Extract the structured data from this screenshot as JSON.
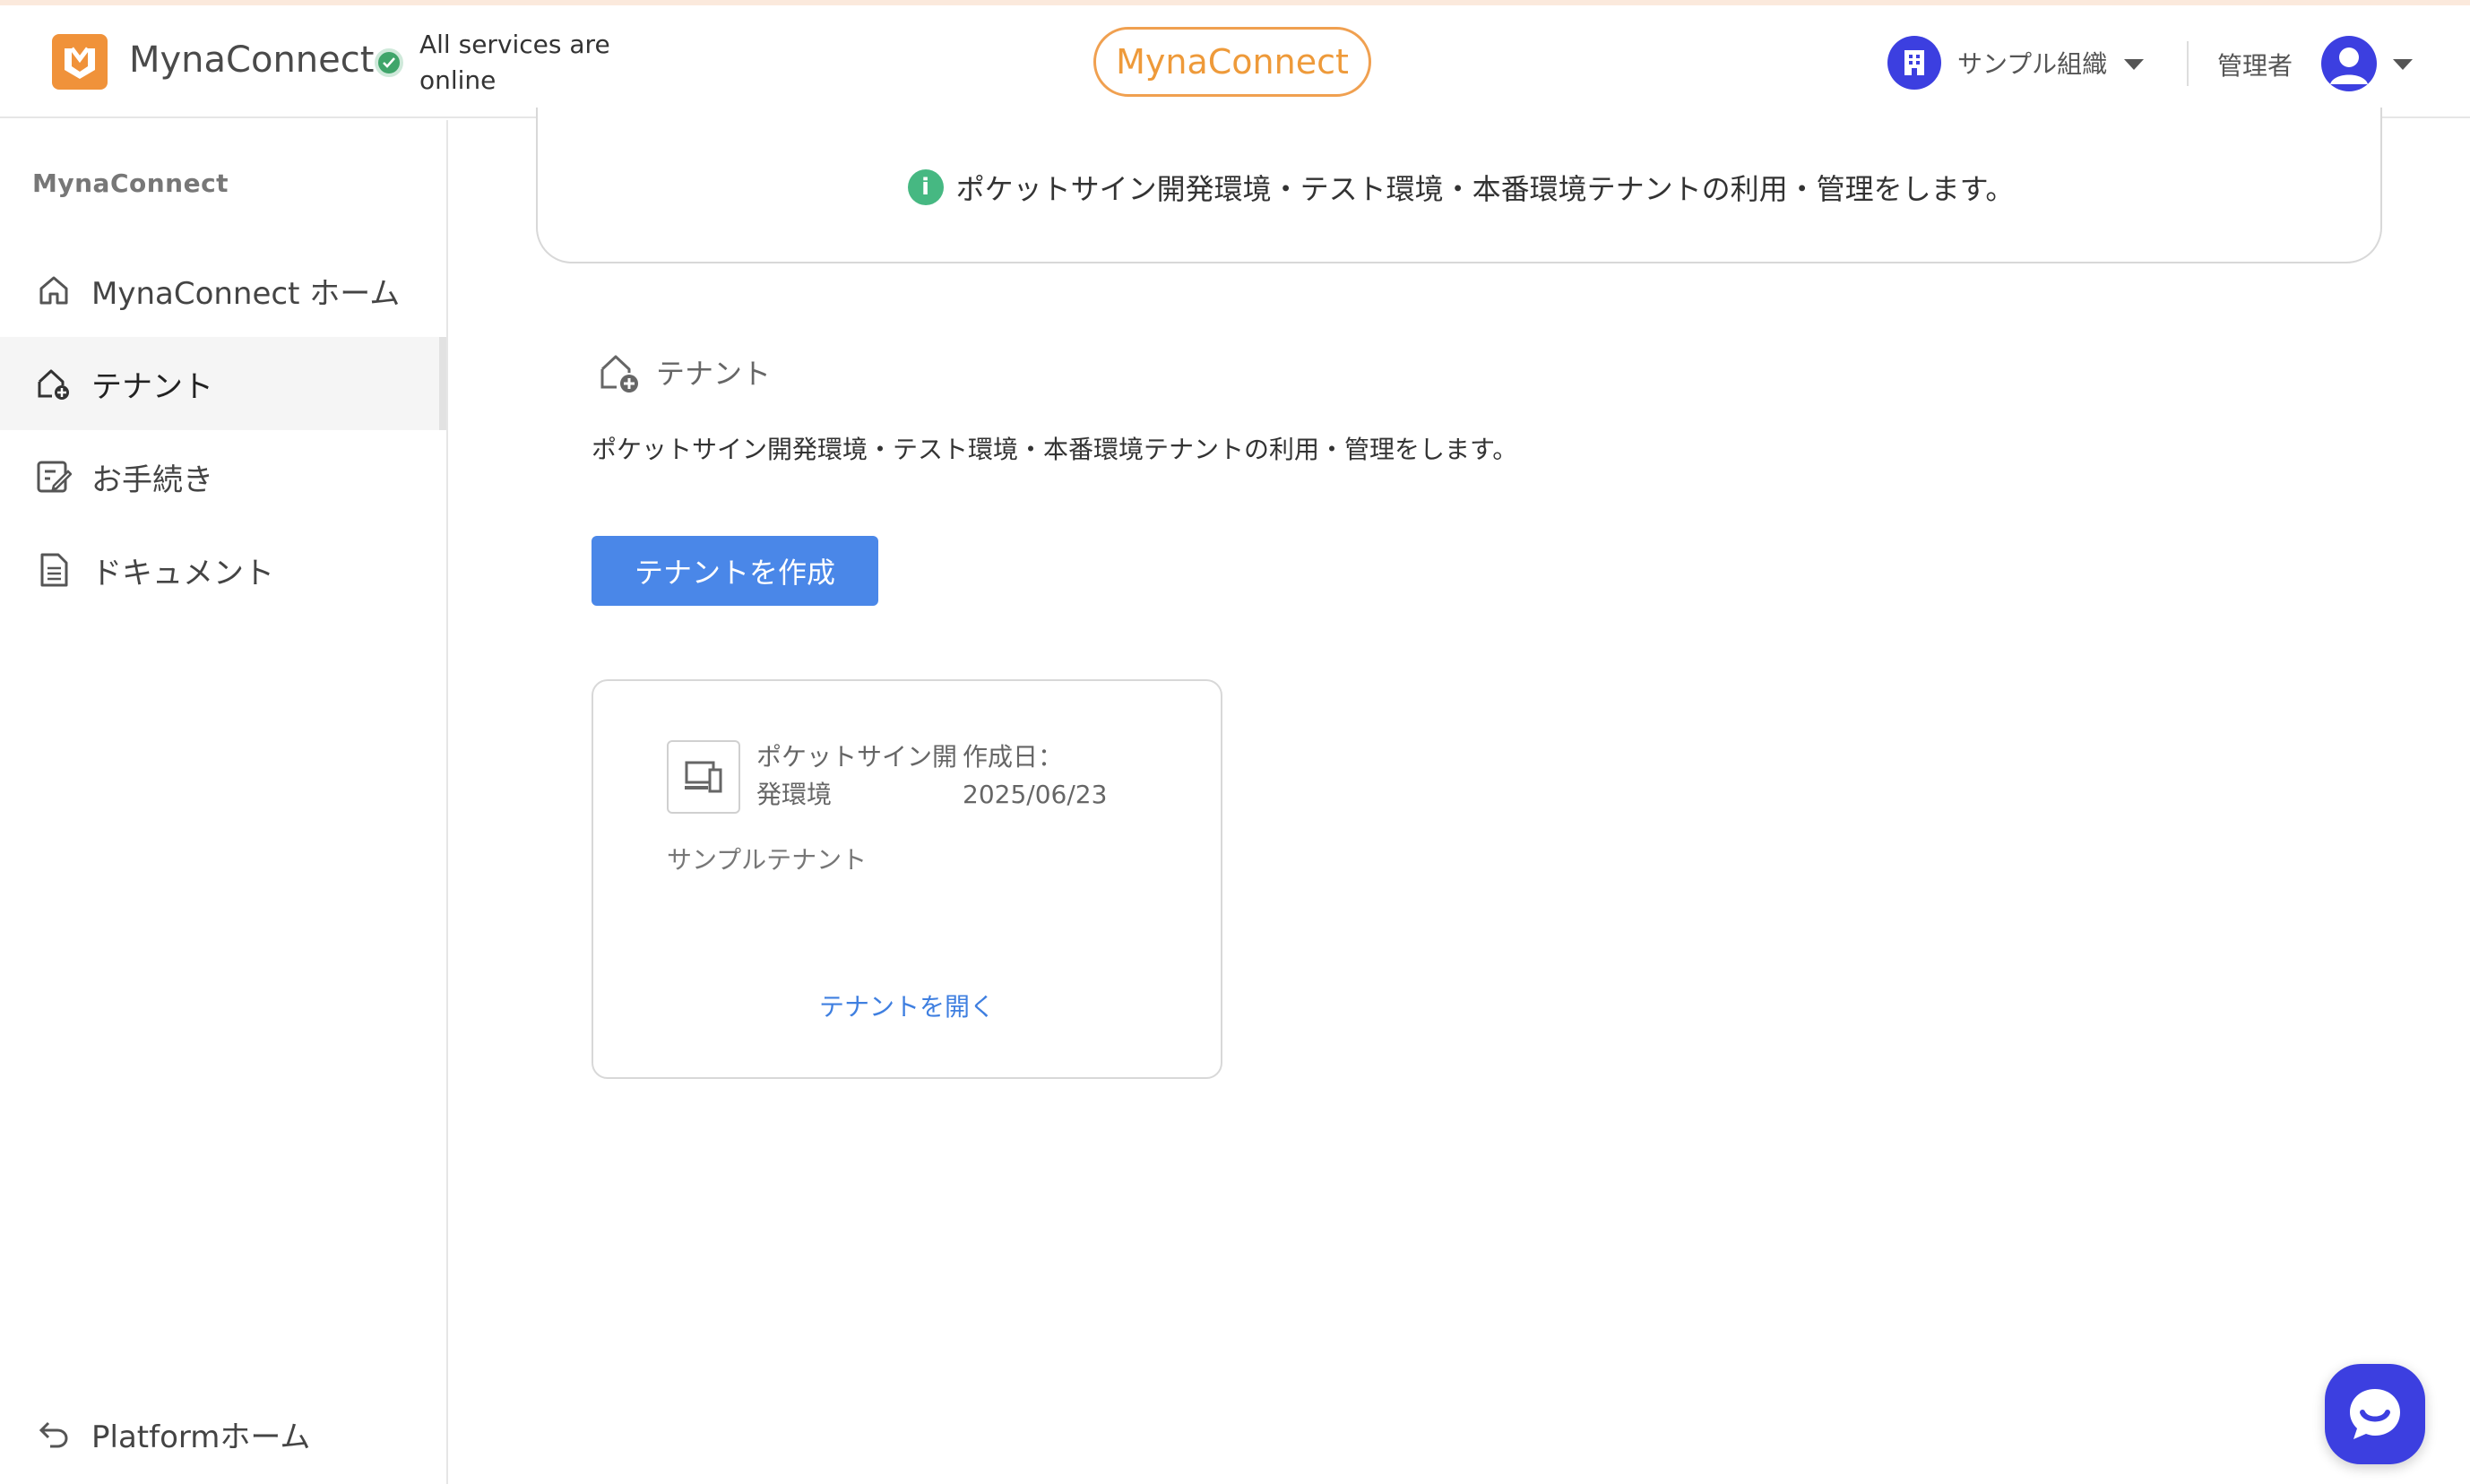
{
  "header": {
    "brand": "MynaConnect",
    "status_text": "All services are online",
    "center_label": "MynaConnect",
    "org_name": "サンプル組織",
    "role": "管理者"
  },
  "sidebar": {
    "heading": "MynaConnect",
    "items": [
      {
        "label": "MynaConnect ホーム",
        "icon": "home-icon",
        "active": false
      },
      {
        "label": "テナント",
        "icon": "tenant-icon",
        "active": true
      },
      {
        "label": "お手続き",
        "icon": "procedure-icon",
        "active": false
      },
      {
        "label": "ドキュメント",
        "icon": "document-icon",
        "active": false
      }
    ],
    "footer_label": "Platformホーム"
  },
  "info_banner": {
    "text": "ポケットサイン開発環境・テスト環境・本番環境テナントの利用・管理をします。"
  },
  "section": {
    "title": "テナント",
    "description": "ポケットサイン開発環境・テスト環境・本番環境テナントの利用・管理をします。",
    "create_button": "テナントを作成"
  },
  "tenant_card": {
    "environment": "ポケットサイン開発環境",
    "created_label": "作成日：",
    "created_date": "2025/06/23",
    "name": "サンプルテナント",
    "open_link": "テナントを開く"
  },
  "colors": {
    "accent": "#4a87e8",
    "brand_orange": "#ee9a3a",
    "status_green": "#46b882",
    "indigo": "#3c3fe0"
  }
}
